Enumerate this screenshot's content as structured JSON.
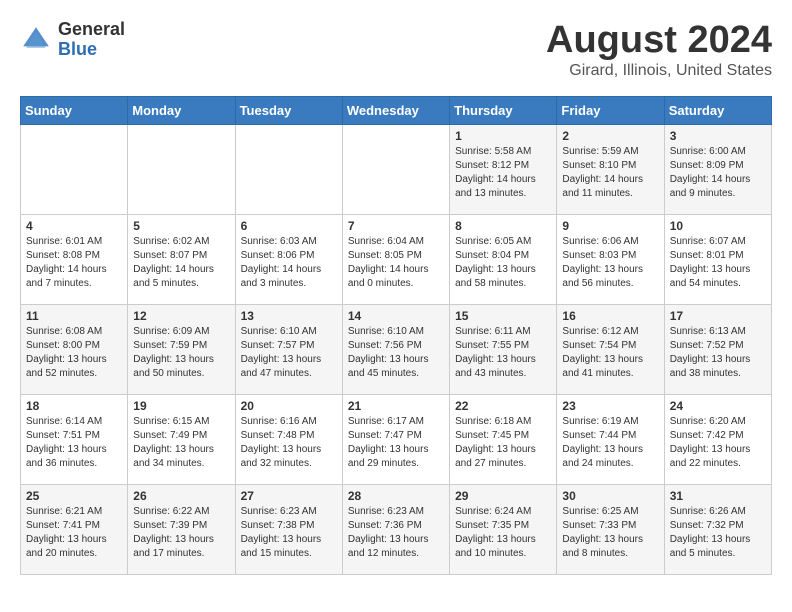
{
  "logo": {
    "general": "General",
    "blue": "Blue"
  },
  "title": "August 2024",
  "location": "Girard, Illinois, United States",
  "weekdays": [
    "Sunday",
    "Monday",
    "Tuesday",
    "Wednesday",
    "Thursday",
    "Friday",
    "Saturday"
  ],
  "weeks": [
    [
      {
        "day": "",
        "info": ""
      },
      {
        "day": "",
        "info": ""
      },
      {
        "day": "",
        "info": ""
      },
      {
        "day": "",
        "info": ""
      },
      {
        "day": "1",
        "info": "Sunrise: 5:58 AM\nSunset: 8:12 PM\nDaylight: 14 hours\nand 13 minutes."
      },
      {
        "day": "2",
        "info": "Sunrise: 5:59 AM\nSunset: 8:10 PM\nDaylight: 14 hours\nand 11 minutes."
      },
      {
        "day": "3",
        "info": "Sunrise: 6:00 AM\nSunset: 8:09 PM\nDaylight: 14 hours\nand 9 minutes."
      }
    ],
    [
      {
        "day": "4",
        "info": "Sunrise: 6:01 AM\nSunset: 8:08 PM\nDaylight: 14 hours\nand 7 minutes."
      },
      {
        "day": "5",
        "info": "Sunrise: 6:02 AM\nSunset: 8:07 PM\nDaylight: 14 hours\nand 5 minutes."
      },
      {
        "day": "6",
        "info": "Sunrise: 6:03 AM\nSunset: 8:06 PM\nDaylight: 14 hours\nand 3 minutes."
      },
      {
        "day": "7",
        "info": "Sunrise: 6:04 AM\nSunset: 8:05 PM\nDaylight: 14 hours\nand 0 minutes."
      },
      {
        "day": "8",
        "info": "Sunrise: 6:05 AM\nSunset: 8:04 PM\nDaylight: 13 hours\nand 58 minutes."
      },
      {
        "day": "9",
        "info": "Sunrise: 6:06 AM\nSunset: 8:03 PM\nDaylight: 13 hours\nand 56 minutes."
      },
      {
        "day": "10",
        "info": "Sunrise: 6:07 AM\nSunset: 8:01 PM\nDaylight: 13 hours\nand 54 minutes."
      }
    ],
    [
      {
        "day": "11",
        "info": "Sunrise: 6:08 AM\nSunset: 8:00 PM\nDaylight: 13 hours\nand 52 minutes."
      },
      {
        "day": "12",
        "info": "Sunrise: 6:09 AM\nSunset: 7:59 PM\nDaylight: 13 hours\nand 50 minutes."
      },
      {
        "day": "13",
        "info": "Sunrise: 6:10 AM\nSunset: 7:57 PM\nDaylight: 13 hours\nand 47 minutes."
      },
      {
        "day": "14",
        "info": "Sunrise: 6:10 AM\nSunset: 7:56 PM\nDaylight: 13 hours\nand 45 minutes."
      },
      {
        "day": "15",
        "info": "Sunrise: 6:11 AM\nSunset: 7:55 PM\nDaylight: 13 hours\nand 43 minutes."
      },
      {
        "day": "16",
        "info": "Sunrise: 6:12 AM\nSunset: 7:54 PM\nDaylight: 13 hours\nand 41 minutes."
      },
      {
        "day": "17",
        "info": "Sunrise: 6:13 AM\nSunset: 7:52 PM\nDaylight: 13 hours\nand 38 minutes."
      }
    ],
    [
      {
        "day": "18",
        "info": "Sunrise: 6:14 AM\nSunset: 7:51 PM\nDaylight: 13 hours\nand 36 minutes."
      },
      {
        "day": "19",
        "info": "Sunrise: 6:15 AM\nSunset: 7:49 PM\nDaylight: 13 hours\nand 34 minutes."
      },
      {
        "day": "20",
        "info": "Sunrise: 6:16 AM\nSunset: 7:48 PM\nDaylight: 13 hours\nand 32 minutes."
      },
      {
        "day": "21",
        "info": "Sunrise: 6:17 AM\nSunset: 7:47 PM\nDaylight: 13 hours\nand 29 minutes."
      },
      {
        "day": "22",
        "info": "Sunrise: 6:18 AM\nSunset: 7:45 PM\nDaylight: 13 hours\nand 27 minutes."
      },
      {
        "day": "23",
        "info": "Sunrise: 6:19 AM\nSunset: 7:44 PM\nDaylight: 13 hours\nand 24 minutes."
      },
      {
        "day": "24",
        "info": "Sunrise: 6:20 AM\nSunset: 7:42 PM\nDaylight: 13 hours\nand 22 minutes."
      }
    ],
    [
      {
        "day": "25",
        "info": "Sunrise: 6:21 AM\nSunset: 7:41 PM\nDaylight: 13 hours\nand 20 minutes."
      },
      {
        "day": "26",
        "info": "Sunrise: 6:22 AM\nSunset: 7:39 PM\nDaylight: 13 hours\nand 17 minutes."
      },
      {
        "day": "27",
        "info": "Sunrise: 6:23 AM\nSunset: 7:38 PM\nDaylight: 13 hours\nand 15 minutes."
      },
      {
        "day": "28",
        "info": "Sunrise: 6:23 AM\nSunset: 7:36 PM\nDaylight: 13 hours\nand 12 minutes."
      },
      {
        "day": "29",
        "info": "Sunrise: 6:24 AM\nSunset: 7:35 PM\nDaylight: 13 hours\nand 10 minutes."
      },
      {
        "day": "30",
        "info": "Sunrise: 6:25 AM\nSunset: 7:33 PM\nDaylight: 13 hours\nand 8 minutes."
      },
      {
        "day": "31",
        "info": "Sunrise: 6:26 AM\nSunset: 7:32 PM\nDaylight: 13 hours\nand 5 minutes."
      }
    ]
  ]
}
